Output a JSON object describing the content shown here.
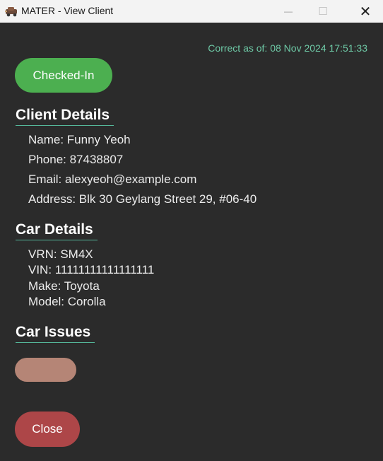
{
  "window": {
    "title": "MATER - View Client",
    "minimize_glyph": "—",
    "maximize_glyph": "☐",
    "close_glyph": "✕"
  },
  "status": {
    "timestamp": "Correct as of: 08 Nov 2024 17:51:33",
    "checked_in_label": "Checked-In",
    "checked_in_color": "#4caf50"
  },
  "client_details": {
    "heading": "Client Details",
    "name": "Name: Funny Yeoh",
    "phone": "Phone: 87438807",
    "email": "Email: alexyeoh@example.com",
    "address": "Address: Blk 30 Geylang Street 29, #06-40"
  },
  "car_details": {
    "heading": "Car Details",
    "vrn": "VRN: SM4X",
    "vin": "VIN: 11111111111111111",
    "make": "Make: Toyota",
    "model": "Model: Corolla"
  },
  "car_issues": {
    "heading": "Car Issues",
    "issue_pill_color": "#b58576"
  },
  "actions": {
    "close_label": "Close",
    "close_color": "#ad4648"
  },
  "icons": {
    "app": "car-app-icon"
  }
}
